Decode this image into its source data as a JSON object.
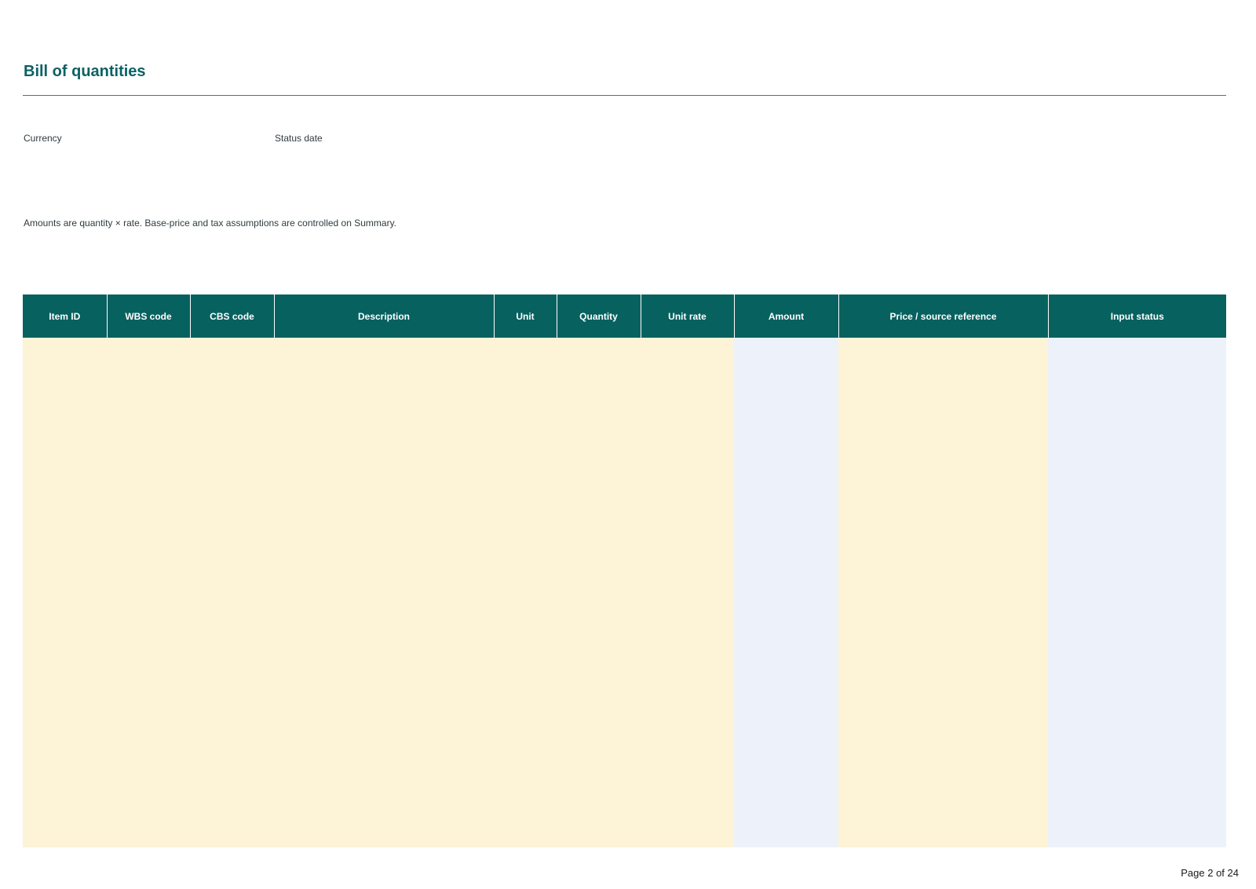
{
  "page": {
    "title": "Bill of quantities",
    "page_number": "Page 2 of 24"
  },
  "meta": {
    "currency_label": "Currency",
    "status_date_label": "Status date"
  },
  "note": "Amounts are quantity × rate. Base-price and tax assumptions are controlled on Summary.",
  "table": {
    "columns": [
      "Item ID",
      "WBS code",
      "CBS code",
      "Description",
      "Unit",
      "Quantity",
      "Unit rate",
      "Amount",
      "Price / source reference",
      "Input status"
    ]
  },
  "colors": {
    "header": "#06615f",
    "title": "#0b6164",
    "input_fill": "#fdf3d6",
    "calculated_fill": "#edf2fa"
  }
}
